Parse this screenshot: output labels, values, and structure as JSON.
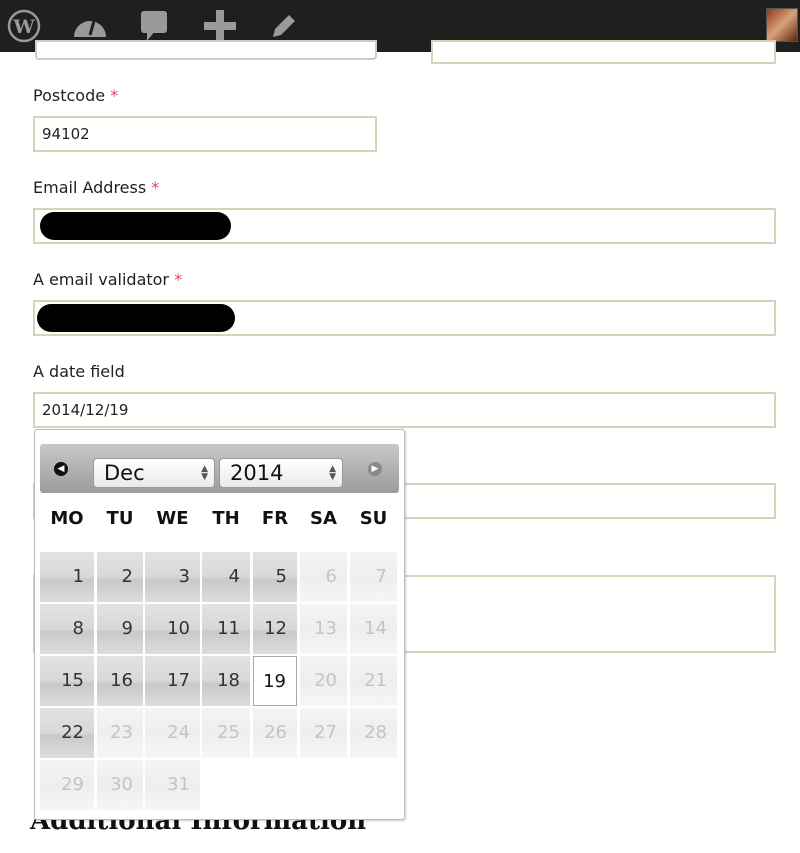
{
  "admin_bar": {
    "icons": [
      "wordpress-icon",
      "dashboard-icon",
      "comments-icon",
      "add-new-icon",
      "edit-icon",
      "user-avatar"
    ]
  },
  "form": {
    "postcode": {
      "label": "Postcode",
      "required": "*",
      "value": "94102"
    },
    "email": {
      "label": "Email Address",
      "required": "*"
    },
    "email_validator": {
      "label": "A email validator",
      "required": "*"
    },
    "date": {
      "label": "A date field",
      "value": "2014/12/19"
    }
  },
  "heading": "Additional Information",
  "datepicker": {
    "month": "Dec",
    "year": "2014",
    "prev_icon": "prev-arrow-icon",
    "next_icon": "next-arrow-icon",
    "weekdays": [
      "MO",
      "TU",
      "WE",
      "TH",
      "FR",
      "SA",
      "SU"
    ],
    "selected_day": 19,
    "days": [
      "1",
      "2",
      "3",
      "4",
      "5",
      "6",
      "7",
      "8",
      "9",
      "10",
      "11",
      "12",
      "13",
      "14",
      "15",
      "16",
      "17",
      "18",
      "19",
      "20",
      "21",
      "22",
      "23",
      "24",
      "25",
      "26",
      "27",
      "28",
      "29",
      "30",
      "31"
    ]
  }
}
